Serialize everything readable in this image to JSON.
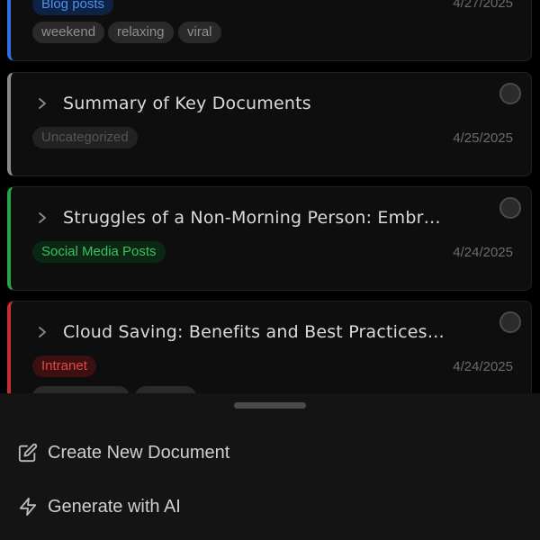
{
  "documents": [
    {
      "title": "",
      "category": "Blog posts",
      "date": "4/27/2025",
      "accent": "#2f6fe0",
      "category_colors": {
        "bg": "#0e2244",
        "fg": "#4d8ef0"
      },
      "tags": [
        "weekend",
        "relaxing",
        "viral"
      ]
    },
    {
      "title": "Summary of Key Documents",
      "category": "Uncategorized",
      "date": "4/25/2025",
      "accent": "#8a8a8a",
      "category_colors": {
        "bg": "#222222",
        "fg": "#555555"
      }
    },
    {
      "title": "Struggles of a Non-Morning Person: Embr…",
      "category": "Social Media Posts",
      "date": "4/24/2025",
      "accent": "#27a344",
      "category_colors": {
        "bg": "#0c2614",
        "fg": "#3cc15e"
      }
    },
    {
      "title": "Cloud Saving: Benefits and Best Practices…",
      "category": "Intranet",
      "date": "4/24/2025",
      "accent": "#c62f2f",
      "category_colors": {
        "bg": "#3a1010",
        "fg": "#e84545"
      }
    }
  ],
  "sheet": {
    "items": [
      {
        "label": "Create New Document",
        "icon": "edit-icon"
      },
      {
        "label": "Generate with AI",
        "icon": "lightning-icon"
      }
    ]
  }
}
